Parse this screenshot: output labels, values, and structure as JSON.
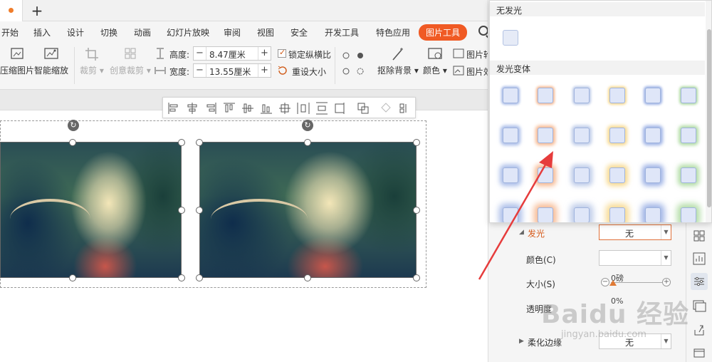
{
  "menu": {
    "items": [
      "开始",
      "插入",
      "设计",
      "切换",
      "动画",
      "幻灯片放映",
      "审阅",
      "视图",
      "安全",
      "开发工具",
      "特色应用",
      "图片工具"
    ],
    "active": "图片工具"
  },
  "toolbar": {
    "compress": "压缩图片",
    "smart_scale": "智能缩放",
    "crop": "裁剪",
    "creative_crop": "创意裁剪",
    "height_label": "高度:",
    "height_value": "8.47厘米",
    "width_label": "宽度:",
    "width_value": "13.55厘米",
    "lock_ratio": "锁定纵横比",
    "reset_size": "重设大小",
    "remove_bg": "抠除背景",
    "color": "颜色",
    "pic_outline": "图片轮",
    "pic_effect": "图片效"
  },
  "glow_popup": {
    "no_glow": "无发光",
    "variants": "发光变体",
    "swatch_colors": [
      "#6f8fd8",
      "#f08a4a",
      "#8fa6d8",
      "#f2c24a",
      "#5b7fd4",
      "#7fc46a"
    ]
  },
  "properties": {
    "glow_label": "发光",
    "glow_value": "无",
    "color_label": "颜色(C)",
    "size_label": "大小(S)",
    "size_value": "0磅",
    "transparency_label": "透明度",
    "transparency_value": "0%",
    "soft_edge_label": "柔化边缘",
    "soft_edge_value": "无"
  },
  "watermark": {
    "brand": "Baidu 经验",
    "url": "jingyan.baidu.com"
  }
}
